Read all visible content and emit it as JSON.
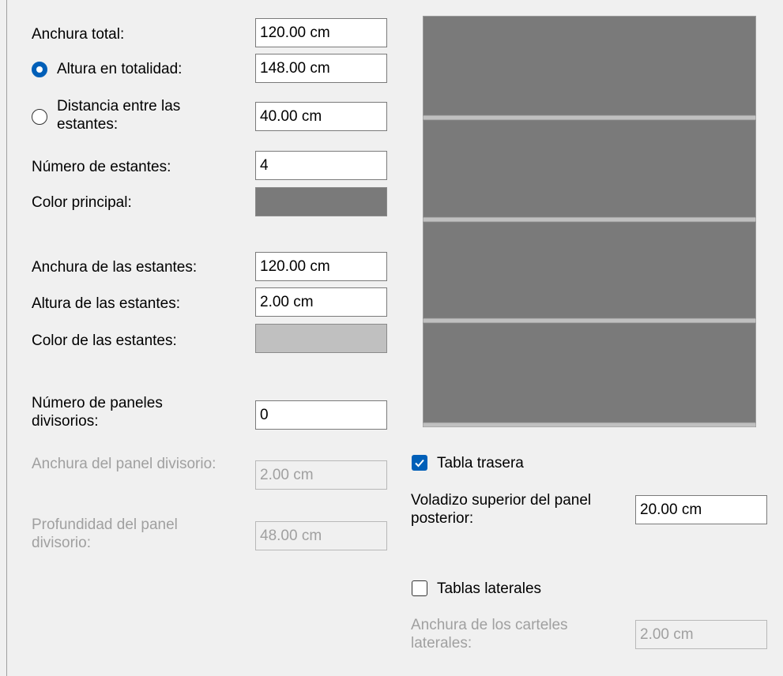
{
  "left": {
    "total_width": {
      "label": "Anchura total:",
      "value": "120.00 cm"
    },
    "total_height": {
      "label": "Altura en totalidad:",
      "value": "148.00 cm",
      "selected": true
    },
    "shelf_distance": {
      "label": "Distancia entre las estantes:",
      "value": "40.00 cm",
      "selected": false
    },
    "shelf_count": {
      "label": "Número de estantes:",
      "value": "4"
    },
    "main_color": {
      "label": "Color principal:",
      "color": "#7a7a7a"
    },
    "shelf_width": {
      "label": "Anchura de las estantes:",
      "value": "120.00 cm"
    },
    "shelf_height": {
      "label": "Altura de las estantes:",
      "value": "2.00 cm"
    },
    "shelf_color": {
      "label": "Color de las estantes:",
      "color": "#c0c0c0"
    },
    "divider_count": {
      "label": "Número de paneles divisorios:",
      "value": "0"
    },
    "divider_width": {
      "label": "Anchura del panel divisorio:",
      "value": "2.00 cm"
    },
    "divider_depth": {
      "label": "Profundidad del panel divisorio:",
      "value": "48.00 cm"
    }
  },
  "right": {
    "back_panel": {
      "label": "Tabla trasera",
      "checked": true
    },
    "back_overhang": {
      "label": "Voladizo superior del panel posterior:",
      "value": "20.00 cm"
    },
    "side_panels": {
      "label": "Tablas laterales",
      "checked": false
    },
    "side_width": {
      "label": "Anchura de los carteles laterales:",
      "value": "2.00 cm"
    }
  },
  "preview": {
    "shelf_count": 4,
    "body_color": "#7a7a7a",
    "shelf_color": "#c0c0c0"
  }
}
